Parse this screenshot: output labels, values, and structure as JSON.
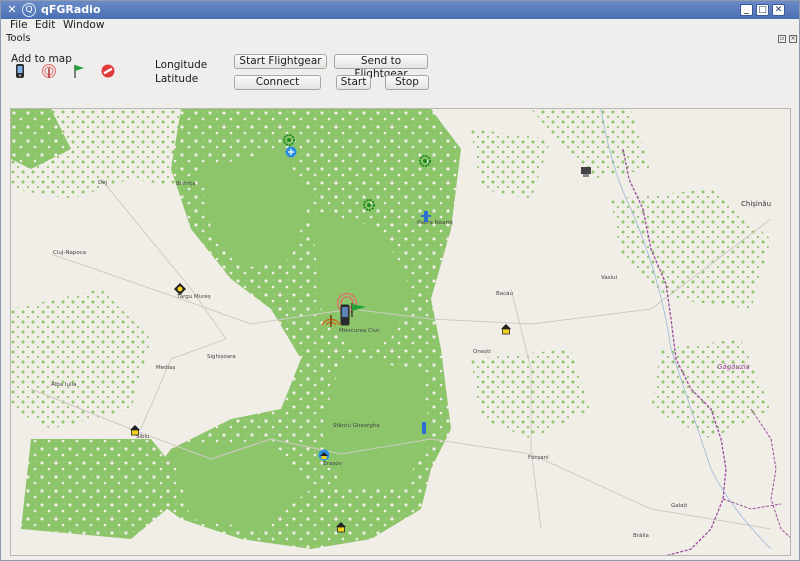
{
  "window": {
    "title": "qFGRadio"
  },
  "menu": {
    "file": "File",
    "edit": "Edit",
    "window": "Window"
  },
  "tools": {
    "title": "Tools",
    "add_to_map": "Add to map",
    "longitude_label": "Longitude",
    "latitude_label": "Latitude",
    "buttons": {
      "start_flightgear": "Start Flightgear",
      "send_to_flightgear": "Send to Flightgear",
      "connect": "Connect",
      "start": "Start",
      "stop": "Stop"
    },
    "add_icons": [
      "mobile-station-icon",
      "radio-tower-icon",
      "flag-icon",
      "no-signal-icon"
    ]
  },
  "map": {
    "cities": {
      "dej": "Dej",
      "bistrita": "Bistrița",
      "cluj": "Cluj-Napoca",
      "targu_mures": "Târgu Mureș",
      "sighisoara": "Sighișoara",
      "medias": "Mediaș",
      "alba_iulia": "Alba Iulia",
      "sibiu": "Sibiu",
      "brasov": "Brașov",
      "sfantu": "Sfântu Gheorghe",
      "miercurea": "Miercurea Ciuc",
      "piatra": "Piatra Neamț",
      "bacau": "Bacău",
      "onesti": "Onești",
      "vaslui": "Vaslui",
      "chisinau": "Chișinău",
      "gagauzia": "Găgăuzia",
      "focsani": "Focșani",
      "galati": "Galați",
      "braila": "Brăila"
    },
    "colors": {
      "forest": "#8dc56b",
      "land": "#f1eee8",
      "border": "#9b4d9b",
      "roads": "#c9c6c0"
    }
  }
}
